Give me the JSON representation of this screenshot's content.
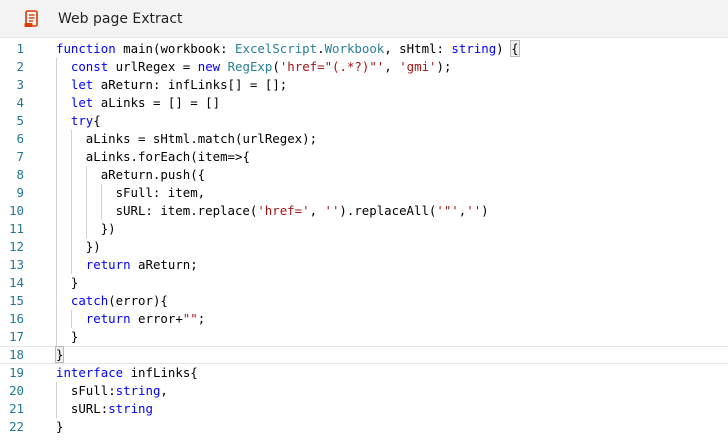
{
  "header": {
    "icon": "script-icon",
    "title": "Web page Extract"
  },
  "editor": {
    "line_numbers": [
      "1",
      "2",
      "3",
      "4",
      "5",
      "6",
      "7",
      "8",
      "9",
      "10",
      "11",
      "12",
      "13",
      "14",
      "15",
      "16",
      "17",
      "18",
      "19",
      "20",
      "21",
      "22"
    ],
    "lines": [
      [
        {
          "t": "function",
          "c": "kw"
        },
        {
          "t": " main(workbook: "
        },
        {
          "t": "ExcelScript",
          "c": "ty"
        },
        {
          "t": "."
        },
        {
          "t": "Workbook",
          "c": "ty"
        },
        {
          "t": ", sHtml: "
        },
        {
          "t": "string",
          "c": "kw"
        },
        {
          "t": ") "
        },
        {
          "t": "{",
          "c": "bm"
        }
      ],
      [
        {
          "t": "const",
          "c": "kw"
        },
        {
          "t": " urlRegex = "
        },
        {
          "t": "new",
          "c": "kw"
        },
        {
          "t": " "
        },
        {
          "t": "RegExp",
          "c": "ty"
        },
        {
          "t": "("
        },
        {
          "t": "'href=\"(.*?)\"'",
          "c": "str"
        },
        {
          "t": ", "
        },
        {
          "t": "'gmi'",
          "c": "str"
        },
        {
          "t": ");"
        }
      ],
      [
        {
          "t": "let",
          "c": "kw"
        },
        {
          "t": " aReturn: infLinks[] = [];"
        }
      ],
      [
        {
          "t": "let",
          "c": "kw"
        },
        {
          "t": " aLinks = [] = []"
        }
      ],
      [
        {
          "t": "try",
          "c": "kw"
        },
        {
          "t": "{"
        }
      ],
      [
        {
          "t": "aLinks = sHtml.match(urlRegex);"
        }
      ],
      [
        {
          "t": "aLinks.forEach(item=>{"
        }
      ],
      [
        {
          "t": "aReturn.push({"
        }
      ],
      [
        {
          "t": "sFull: item,"
        }
      ],
      [
        {
          "t": "sURL: item.replace("
        },
        {
          "t": "'href='",
          "c": "str"
        },
        {
          "t": ", "
        },
        {
          "t": "''",
          "c": "str"
        },
        {
          "t": ").replaceAll("
        },
        {
          "t": "'\"'",
          "c": "str"
        },
        {
          "t": ","
        },
        {
          "t": "''",
          "c": "str"
        },
        {
          "t": ")"
        }
      ],
      [
        {
          "t": "})"
        }
      ],
      [
        {
          "t": "})"
        }
      ],
      [
        {
          "t": "return",
          "c": "kw"
        },
        {
          "t": " aReturn;"
        }
      ],
      [
        {
          "t": "}"
        }
      ],
      [
        {
          "t": "catch",
          "c": "kw"
        },
        {
          "t": "(error){"
        }
      ],
      [
        {
          "t": "return",
          "c": "kw"
        },
        {
          "t": " error+"
        },
        {
          "t": "\"\"",
          "c": "str"
        },
        {
          "t": ";"
        }
      ],
      [
        {
          "t": "}"
        }
      ],
      [
        {
          "t": "}",
          "c": "bm"
        }
      ],
      [
        {
          "t": "interface",
          "c": "kw"
        },
        {
          "t": " infLinks{"
        }
      ],
      [
        {
          "t": "sFull:"
        },
        {
          "t": "string",
          "c": "kw"
        },
        {
          "t": ","
        }
      ],
      [
        {
          "t": "sURL:"
        },
        {
          "t": "string",
          "c": "kw"
        }
      ],
      [
        {
          "t": "}"
        }
      ]
    ]
  },
  "colors": {
    "keyword": "#0000ff",
    "string": "#a31515",
    "type": "#267f99",
    "line_number": "#237893",
    "icon": "#d83b01"
  }
}
